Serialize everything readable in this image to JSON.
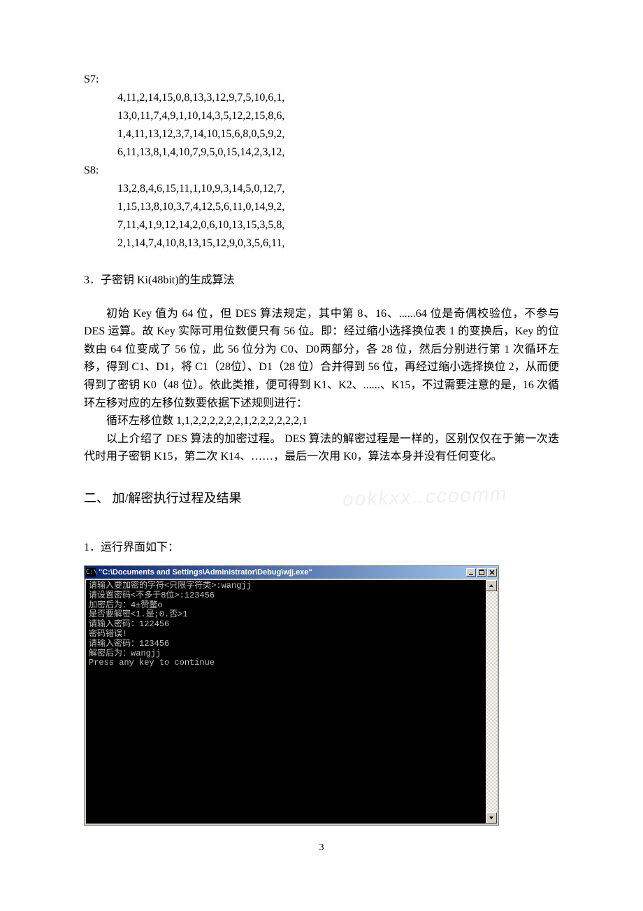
{
  "sbox": {
    "s7_label": "S7:",
    "s7_rows": [
      "4,11,2,14,15,0,8,13,3,12,9,7,5,10,6,1,",
      "13,0,11,7,4,9,1,10,14,3,5,12,2,15,8,6,",
      "1,4,11,13,12,3,7,14,10,15,6,8,0,5,9,2,",
      "6,11,13,8,1,4,10,7,9,5,0,15,14,2,3,12,"
    ],
    "s8_label": "S8:",
    "s8_rows": [
      "13,2,8,4,6,15,11,1,10,9,3,14,5,0,12,7,",
      "1,15,13,8,10,3,7,4,12,5,6,11,0,14,9,2,",
      "7,11,4,1,9,12,14,2,0,6,10,13,15,3,5,8,",
      "2,1,14,7,4,10,8,13,15,12,9,0,3,5,6,11,"
    ]
  },
  "section3": {
    "heading": "3．子密钥 Ki(48bit)的生成算法",
    "para1": "初始 Key 值为 64 位，但 DES 算法规定，其中第 8、16、......64 位是奇偶校验位，不参与 DES 运算。故 Key  实际可用位数便只有 56 位。即：经过缩小选择换位表 1 的变换后，Key  的位数由 64  位变成了 56 位，此 56 位分为 C0、D0两部分，各 28 位，然后分别进行第 1 次循环左移，得到 C1、D1，将 C1（28位）、D1（28 位）合并得到 56 位，再经过缩小选择换位 2，从而便得到了密钥 K0（48 位）。依此类推，便可得到 K1、K2、......、K15，不过需要注意的是，16 次循环左移对应的左移位数要依据下述规则进行：",
    "shift_line": "循环左移位数 1,1,2,2,2,2,2,2,1,2,2,2,2,2,2,1",
    "para2": "以上介绍了 DES 算法的加密过程。 DES 算法的解密过程是一样的，区别仅仅在于第一次迭代时用子密钥 K15，第二次 K14、……，最后一次用 K0，算法本身并没有任何变化。"
  },
  "section2": {
    "heading": "二、   加/解密执行过程及结果",
    "sub1": "1．运行界面如下："
  },
  "console": {
    "title": "\"C:\\Documents and Settings\\Administrator\\Debug\\wjj.exe\"",
    "icon_text": "C:\\",
    "lines": [
      "请输入要加密的字符<只限字符类>:wangjj",
      "请设置密码<不多于8位>:123456",
      "加密后为：4±赞鳖o",
      "是否要解密<1.是;0.否>1",
      "请输入密码：122456",
      "密码错误!",
      "请输入密码：123456",
      "解密后为：wangjj",
      "Press any key to continue"
    ]
  },
  "page_number": "3",
  "watermark": "ookkxx..ccoomm"
}
